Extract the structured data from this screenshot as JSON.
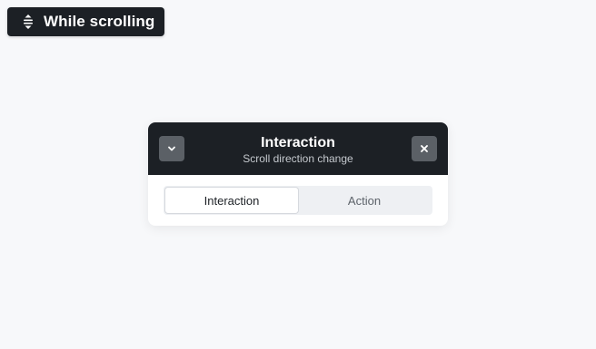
{
  "trigger": {
    "label": "While scrolling",
    "icon": "scroll-direction-icon"
  },
  "panel": {
    "title": "Interaction",
    "subtitle": "Scroll direction change",
    "collapse_icon": "chevron-down-icon",
    "close_icon": "close-icon",
    "tabs": [
      {
        "label": "Interaction",
        "active": true
      },
      {
        "label": "Action",
        "active": false
      }
    ]
  },
  "colors": {
    "background": "#f7f8fa",
    "dark": "#1c2025",
    "button_gray": "#5b6066",
    "tab_track": "#eef0f3"
  }
}
